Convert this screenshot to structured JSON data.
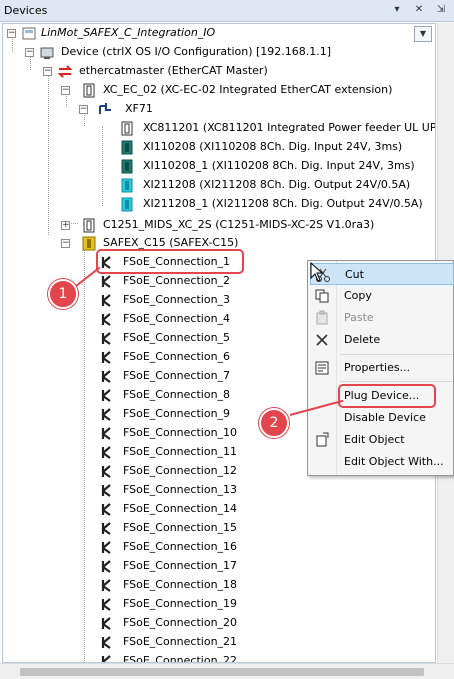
{
  "window": {
    "title": "Devices",
    "buttons": [
      "▾",
      "✕",
      "⇲"
    ]
  },
  "tree": {
    "root": "LinMot_SAFEX_C_Integration_IO",
    "device": "Device (ctrlX OS I/O Configuration) [192.168.1.1]",
    "master": "ethercatmaster (EtherCAT Master)",
    "xc": "XC_EC_02 (XC-EC-02 Integrated EtherCAT extension)",
    "xf": "XF71",
    "modules": [
      "XC811201 (XC811201 Integrated Power feeder UL UP)",
      "XI110208 (XI110208 8Ch. Dig. Input 24V, 3ms)",
      "XI110208_1 (XI110208 8Ch. Dig. Input 24V, 3ms)",
      "XI211208 (XI211208 8Ch. Dig. Output 24V/0.5A)",
      "XI211208_1 (XI211208 8Ch. Dig. Output 24V/0.5A)"
    ],
    "c1251": "C1251_MIDS_XC_2S (C1251-MIDS-XC-2S V1.0ra3)",
    "safex": "SAFEX_C15 (SAFEX-C15)",
    "connections": [
      "FSoE_Connection_1",
      "FSoE_Connection_2",
      "FSoE_Connection_3",
      "FSoE_Connection_4",
      "FSoE_Connection_5",
      "FSoE_Connection_6",
      "FSoE_Connection_7",
      "FSoE_Connection_8",
      "FSoE_Connection_9",
      "FSoE_Connection_10",
      "FSoE_Connection_11",
      "FSoE_Connection_12",
      "FSoE_Connection_13",
      "FSoE_Connection_14",
      "FSoE_Connection_15",
      "FSoE_Connection_16",
      "FSoE_Connection_17",
      "FSoE_Connection_18",
      "FSoE_Connection_19",
      "FSoE_Connection_20",
      "FSoE_Connection_21",
      "FSoE_Connection_22"
    ]
  },
  "context_menu": {
    "items": [
      {
        "label": "Cut",
        "icon": "scissors-icon",
        "enabled": true,
        "hover": true
      },
      {
        "label": "Copy",
        "icon": "copy-icon",
        "enabled": true
      },
      {
        "label": "Paste",
        "icon": "paste-icon",
        "enabled": false
      },
      {
        "label": "Delete",
        "icon": "delete-icon",
        "enabled": true
      },
      {
        "label": "Properties...",
        "icon": "properties-icon",
        "enabled": true
      },
      {
        "label": "Plug Device...",
        "icon": "",
        "enabled": true
      },
      {
        "label": "Disable Device",
        "icon": "",
        "enabled": true
      },
      {
        "label": "Edit Object",
        "icon": "edit-object-icon",
        "enabled": true
      },
      {
        "label": "Edit Object With...",
        "icon": "",
        "enabled": true
      }
    ]
  },
  "callouts": [
    "1",
    "2"
  ],
  "colors": {
    "callout": "#e2454b",
    "input_module": "#1b7c6f",
    "output_module": "#27c9e0",
    "safex": "#e8c21c",
    "menu_hover": "#cde4f7"
  }
}
